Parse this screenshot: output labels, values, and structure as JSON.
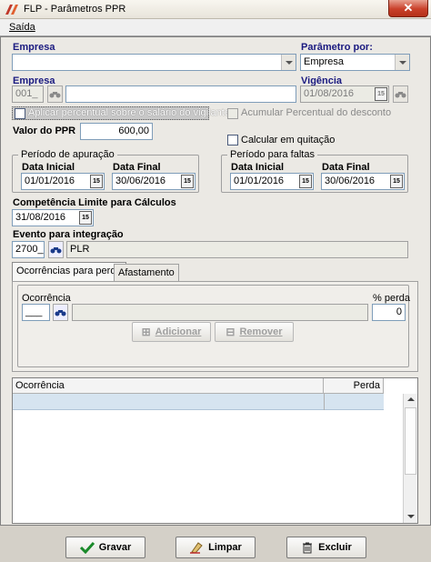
{
  "window": {
    "title": "FLP - Parâmetros PPR"
  },
  "menu": {
    "saida": "Saída"
  },
  "empresa_combo": {
    "label": "Empresa",
    "value": ""
  },
  "parametro": {
    "label": "Parâmetro por:",
    "value": "Empresa"
  },
  "empresa": {
    "label": "Empresa",
    "code": "001_",
    "name": ""
  },
  "vigencia": {
    "label": "Vigência",
    "value": "01/08/2016"
  },
  "aplicar_checkbox": {
    "label": "Aplicar percentual sobre o salário do vigilante"
  },
  "acumular_checkbox": {
    "label": "Acumular Percentual do desconto"
  },
  "valor_ppr": {
    "label": "Valor do PPR",
    "value": "600,00"
  },
  "calcular_checkbox": {
    "label": "Calcular em quitação"
  },
  "periodo_apuracao": {
    "title": "Período de apuração",
    "inicial_label": "Data Inicial",
    "inicial": "01/01/2016",
    "final_label": "Data Final",
    "final": "30/06/2016"
  },
  "periodo_faltas": {
    "title": "Período para faltas",
    "inicial_label": "Data Inicial",
    "inicial": "01/01/2016",
    "final_label": "Data Final",
    "final": "30/06/2016"
  },
  "competencia": {
    "label": "Competência Limite para Cálculos",
    "value": "31/08/2016"
  },
  "evento": {
    "label": "Evento para integração",
    "code": "2700_",
    "name": "PLR"
  },
  "tabs": [
    {
      "label": "Ocorrências para perda"
    },
    {
      "label": "Afastamento"
    }
  ],
  "ocorrencia_panel": {
    "ocorrencia_label": "Ocorrência",
    "ocorrencia_value": "___",
    "perda_label": "% perda",
    "perda_value": "0",
    "adicionar": "Adicionar",
    "remover": "Remover"
  },
  "grid": {
    "columns": [
      "Ocorrência",
      "Perda"
    ]
  },
  "buttons": {
    "gravar": "Gravar",
    "limpar": "Limpar",
    "excluir": "Excluir"
  },
  "cal_icon_text": "15"
}
